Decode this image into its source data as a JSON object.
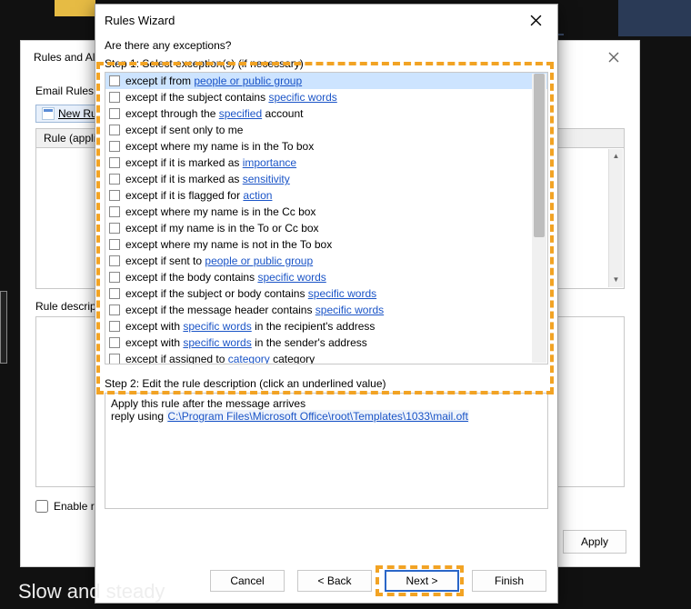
{
  "back_window": {
    "title": "Rules and Alerts",
    "tab": "Email Rules",
    "new_rule": "New Rule...",
    "col_rule": "Rule (applied in the order shown)",
    "rule_desc_label": "Rule description (click an underlined value to edit):",
    "enable_label": "Enable rules on all messages downloaded from RSS Feeds",
    "apply_btn": "Apply"
  },
  "wizard": {
    "title": "Rules Wizard",
    "question": "Are there any exceptions?",
    "step1": "Step 1: Select exception(s) (if necessary)",
    "step2": "Step 2: Edit the rule description (click an underlined value)",
    "desc_line1": "Apply this rule after the message arrives",
    "desc_line2_pre": "reply using ",
    "desc_line2_link": "C:\\Program Files\\Microsoft Office\\root\\Templates\\1033\\mail.oft",
    "buttons": {
      "cancel": "Cancel",
      "back": "< Back",
      "next": "Next >",
      "finish": "Finish"
    }
  },
  "exceptions": [
    {
      "pre": "except if from ",
      "link": "people or public group",
      "post": "",
      "selected": true
    },
    {
      "pre": "except if the subject contains ",
      "link": "specific words",
      "post": ""
    },
    {
      "pre": "except through the ",
      "link": "specified",
      "post": " account"
    },
    {
      "pre": "except if sent only to me",
      "link": "",
      "post": ""
    },
    {
      "pre": "except where my name is in the To box",
      "link": "",
      "post": ""
    },
    {
      "pre": "except if it is marked as ",
      "link": "importance",
      "post": ""
    },
    {
      "pre": "except if it is marked as ",
      "link": "sensitivity",
      "post": ""
    },
    {
      "pre": "except if it is flagged for ",
      "link": "action",
      "post": ""
    },
    {
      "pre": "except where my name is in the Cc box",
      "link": "",
      "post": ""
    },
    {
      "pre": "except if my name is in the To or Cc box",
      "link": "",
      "post": ""
    },
    {
      "pre": "except where my name is not in the To box",
      "link": "",
      "post": ""
    },
    {
      "pre": "except if sent to ",
      "link": "people or public group",
      "post": ""
    },
    {
      "pre": "except if the body contains ",
      "link": "specific words",
      "post": ""
    },
    {
      "pre": "except if the subject or body contains ",
      "link": "specific words",
      "post": ""
    },
    {
      "pre": "except if the message header contains ",
      "link": "specific words",
      "post": ""
    },
    {
      "pre": "except with ",
      "link": "specific words",
      "post": " in the recipient's address"
    },
    {
      "pre": "except with ",
      "link": "specific words",
      "post": " in the sender's address"
    },
    {
      "pre": "except if assigned to ",
      "link": "category",
      "post": " category"
    }
  ],
  "bottom_text": "Slow and steady"
}
